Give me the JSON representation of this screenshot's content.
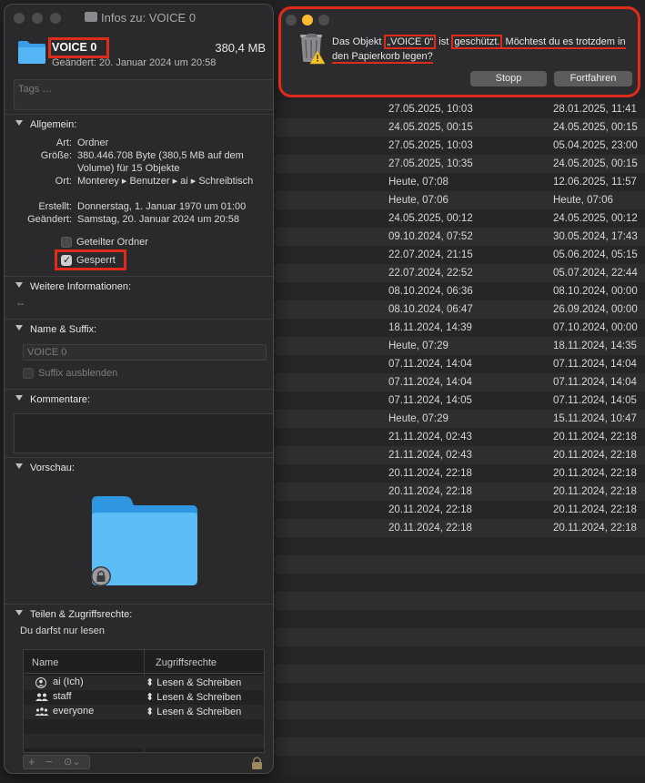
{
  "info_window": {
    "title": "Infos zu: VOICE 0",
    "item_name": "VOICE 0",
    "item_size": "380,4 MB",
    "item_modified": "Geändert: 20. Januar 2024 um 20:58",
    "tags_placeholder": "Tags …",
    "general": {
      "header": "Allgemein:",
      "rows": [
        {
          "key": "Art:",
          "value": "Ordner"
        },
        {
          "key": "Größe:",
          "value": "380.446.708 Byte (380,5 MB auf dem Volume) für 15 Objekte"
        },
        {
          "key": "Ort:",
          "value": "Monterey ▸ Benutzer ▸ ai ▸ Schreibtisch"
        },
        {
          "key": "Erstellt:",
          "value": "Donnerstag, 1. Januar 1970 um 01:00"
        },
        {
          "key": "Geändert:",
          "value": "Samstag, 20. Januar 2024 um 20:58"
        }
      ],
      "shared_folder_label": "Geteilter Ordner",
      "shared_folder_checked": false,
      "locked_label": "Gesperrt",
      "locked_checked": true
    },
    "more_info": {
      "header": "Weitere Informationen:",
      "value": "--"
    },
    "name_suffix": {
      "header": "Name & Suffix:",
      "name_value": "VOICE 0",
      "hide_suffix_label": "Suffix ausblenden"
    },
    "comments": {
      "header": "Kommentare:"
    },
    "preview": {
      "header": "Vorschau:"
    },
    "sharing": {
      "header": "Teilen & Zugriffsrechte:",
      "note": "Du darfst nur lesen",
      "col_name": "Name",
      "col_rights": "Zugriffsrechte",
      "rows": [
        {
          "name": "ai (Ich)",
          "rights": "⬍ Lesen & Schreiben",
          "icon": "person-icon"
        },
        {
          "name": "staff",
          "rights": "⬍ Lesen & Schreiben",
          "icon": "group-icon"
        },
        {
          "name": "everyone",
          "rights": "⬍ Lesen & Schreiben",
          "icon": "everyone-icon"
        }
      ],
      "add_label": "+",
      "remove_label": "−",
      "action_label": "⊙⌄"
    }
  },
  "alert": {
    "msg_part1": "Das Objekt ",
    "msg_name": "„VOICE 0“",
    "msg_part2": " ist ",
    "msg_protected": "geschützt.",
    "msg_part3": " Möchtest du es trotzdem in den Papierkorb legen?",
    "stop_label": "Stopp",
    "continue_label": "Fortfahren"
  },
  "finder_rows": [
    [
      "27.05.2025, 10:03",
      "28.01.2025, 11:41"
    ],
    [
      "24.05.2025, 00:15",
      "24.05.2025, 00:15"
    ],
    [
      "27.05.2025, 10:03",
      "05.04.2025, 23:00"
    ],
    [
      "27.05.2025, 10:35",
      "24.05.2025, 00:15"
    ],
    [
      "Heute, 07:08",
      "12.06.2025, 11:57"
    ],
    [
      "Heute, 07:06",
      "Heute, 07:06"
    ],
    [
      "24.05.2025, 00:12",
      "24.05.2025, 00:12"
    ],
    [
      "09.10.2024, 07:52",
      "30.05.2024, 17:43"
    ],
    [
      "22.07.2024, 21:15",
      "05.06.2024, 05:15"
    ],
    [
      "22.07.2024, 22:52",
      "05.07.2024, 22:44"
    ],
    [
      "08.10.2024, 06:36",
      "08.10.2024, 00:00"
    ],
    [
      "08.10.2024, 06:47",
      "26.09.2024, 00:00"
    ],
    [
      "18.11.2024, 14:39",
      "07.10.2024, 00:00"
    ],
    [
      "Heute, 07:29",
      "18.11.2024, 14:35"
    ],
    [
      "07.11.2024, 14:04",
      "07.11.2024, 14:04"
    ],
    [
      "07.11.2024, 14:04",
      "07.11.2024, 14:04"
    ],
    [
      "07.11.2024, 14:05",
      "07.11.2024, 14:05"
    ],
    [
      "Heute, 07:29",
      "15.11.2024, 10:47"
    ],
    [
      "21.11.2024, 02:43",
      "20.11.2024, 22:18"
    ],
    [
      "21.11.2024, 02:43",
      "20.11.2024, 22:18"
    ],
    [
      "20.11.2024, 22:18",
      "20.11.2024, 22:18"
    ],
    [
      "20.11.2024, 22:18",
      "20.11.2024, 22:18"
    ],
    [
      "20.11.2024, 22:18",
      "20.11.2024, 22:18"
    ],
    [
      "20.11.2024, 22:18",
      "20.11.2024, 22:18"
    ]
  ]
}
